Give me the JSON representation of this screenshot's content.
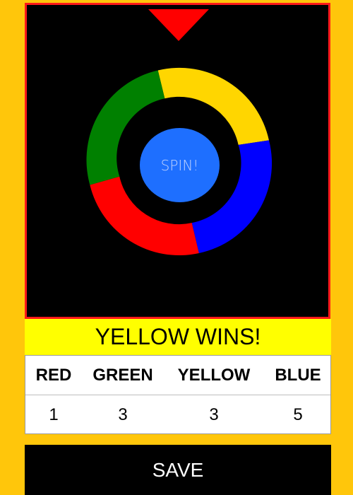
{
  "wheel": {
    "segments": [
      {
        "color_name": "yellow",
        "color": "#FFD600"
      },
      {
        "color_name": "blue",
        "color": "#0000FF"
      },
      {
        "color_name": "red",
        "color": "#FF0000"
      },
      {
        "color_name": "green",
        "color": "#008000"
      }
    ],
    "spin_label": "SPIN!",
    "spin_button_color": "#1E6FFF",
    "pointer_color": "#FF0000",
    "pointer_icon": "triangle-down-pointer"
  },
  "result": {
    "message": "YELLOW WINS!"
  },
  "scores": {
    "headers": [
      "RED",
      "GREEN",
      "YELLOW",
      "BLUE"
    ],
    "values": [
      "1",
      "3",
      "3",
      "5"
    ]
  },
  "save_label": "SAVE"
}
